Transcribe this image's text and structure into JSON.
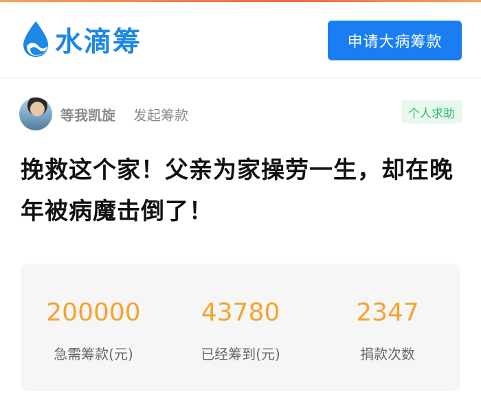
{
  "header": {
    "logo_text": "水滴筹",
    "apply_button": "申请大病筹款"
  },
  "author": {
    "name": "等我凯旋",
    "action": "发起筹款",
    "category": "个人求助"
  },
  "campaign": {
    "title": "挽救这个家！父亲为家操劳一生，却在晚年被病魔击倒了！"
  },
  "stats": [
    {
      "value": "200000",
      "label": "急需筹款(元)"
    },
    {
      "value": "43780",
      "label": "已经筹到(元)"
    },
    {
      "value": "2347",
      "label": "捐款次数"
    }
  ],
  "colors": {
    "brand_blue": "#1a7ef2",
    "stat_orange": "#f7a22e",
    "badge_green": "#2dbb6a"
  }
}
